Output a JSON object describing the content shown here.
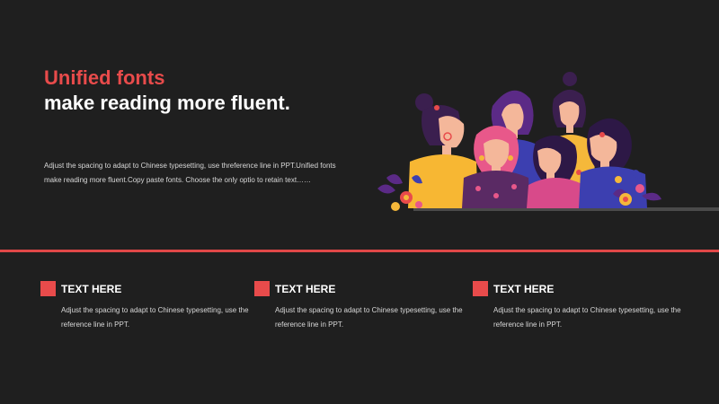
{
  "colors": {
    "background": "#1f1f1f",
    "accent": "#e84b4b",
    "text": "#ffffff",
    "muted_text": "#d8d8d8",
    "divider": "#e04848"
  },
  "header": {
    "title_accent": "Unified fonts",
    "title_main": "make reading more fluent."
  },
  "intro": {
    "text": "Adjust the spacing to adapt to Chinese typesetting, use threference line in PPT.Unified fonts make reading more fluent.Copy paste fonts. Choose the only optio to retain text……"
  },
  "illustration": {
    "icon": "group-of-women-illustration"
  },
  "features": [
    {
      "icon": "red-square-icon",
      "title": "TEXT HERE",
      "description": "Adjust the spacing to adapt to Chinese typesetting, use the reference line in PPT."
    },
    {
      "icon": "red-square-icon",
      "title": "TEXT HERE",
      "description": "Adjust the spacing to adapt to Chinese typesetting, use the reference line in PPT."
    },
    {
      "icon": "red-square-icon",
      "title": "TEXT HERE",
      "description": "Adjust the spacing to adapt to Chinese typesetting, use the reference line in PPT."
    }
  ]
}
